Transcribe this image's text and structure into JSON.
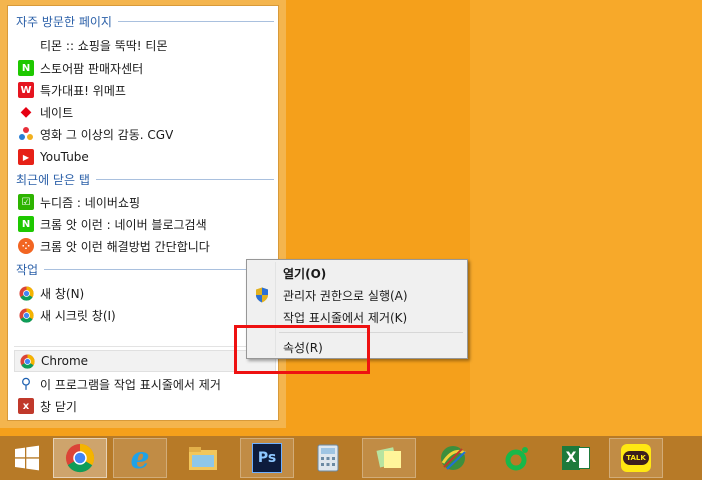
{
  "jumplist": {
    "frequent_header": "자주 방문한 페이지",
    "frequent": [
      {
        "label": "티몬 :: 쇼핑을 뚝딱! 티몬",
        "icon": "blank-icon"
      },
      {
        "label": "스토어팜 판매자센터",
        "icon": "naver-n-icon",
        "glyph": "N",
        "color": "#1ec800"
      },
      {
        "label": "특가대표! 위메프",
        "icon": "wemakeprice-w-icon",
        "glyph": "W",
        "color": "#e5141f"
      },
      {
        "label": "네이트",
        "icon": "nate-cube-icon",
        "glyph": "◆",
        "color": "#e60012"
      },
      {
        "label": "영화 그 이상의 감동. CGV",
        "icon": "cgv-dots-icon",
        "glyph": "✿",
        "color": "#ffffff"
      },
      {
        "label": "YouTube",
        "icon": "youtube-play-icon",
        "glyph": "▶",
        "color": "#e62117"
      }
    ],
    "recent_header": "최근에 닫은 탭",
    "recent": [
      {
        "label": "누디즘 : 네이버쇼핑",
        "icon": "naver-shopping-icon",
        "glyph": "☑",
        "color": "#2db400"
      },
      {
        "label": "크롬 앗 이런 : 네이버 블로그검색",
        "icon": "naver-n-icon",
        "glyph": "N",
        "color": "#1ec800"
      },
      {
        "label": "크롬 앗 이런 해결방법 간단합니다",
        "icon": "orange-dots-icon",
        "glyph": "⁘",
        "color": "#f26522"
      }
    ],
    "tasks_header": "작업",
    "tasks": [
      {
        "label": "새 창(N)",
        "icon": "chrome-icon"
      },
      {
        "label": "새 시크릿 창(I)",
        "icon": "chrome-icon"
      }
    ],
    "footer": [
      {
        "label": "Chrome",
        "icon": "chrome-icon"
      },
      {
        "label": "이 프로그램을 작업 표시줄에서 제거",
        "icon": "unpin-icon",
        "glyph": "⚲",
        "color": "#1b5fb0"
      },
      {
        "label": "창 닫기",
        "icon": "close-window-icon",
        "glyph": "x",
        "color": "#c0392b"
      }
    ]
  },
  "context_menu": {
    "open": "열기(O)",
    "run_as_admin": "관리자 권한으로 실행(A)",
    "unpin": "작업 표시줄에서 제거(K)",
    "properties": "속성(R)"
  },
  "taskbar": {
    "items": [
      {
        "name": "start-button",
        "label": ""
      },
      {
        "name": "chrome",
        "label": ""
      },
      {
        "name": "internet-explorer",
        "label": "e"
      },
      {
        "name": "file-explorer",
        "label": ""
      },
      {
        "name": "photoshop",
        "label": "Ps"
      },
      {
        "name": "calculator",
        "label": ""
      },
      {
        "name": "sticky-notes",
        "label": ""
      },
      {
        "name": "paint-app",
        "label": ""
      },
      {
        "name": "green-ring-app",
        "label": ""
      },
      {
        "name": "excel",
        "label": "X"
      },
      {
        "name": "kakaotalk",
        "label": "TALK"
      }
    ]
  },
  "colors": {
    "desktop": "#f5a01b",
    "taskbar": "#b77a27",
    "header_text": "#2a5fa8",
    "highlight_box": "#ee1111"
  }
}
